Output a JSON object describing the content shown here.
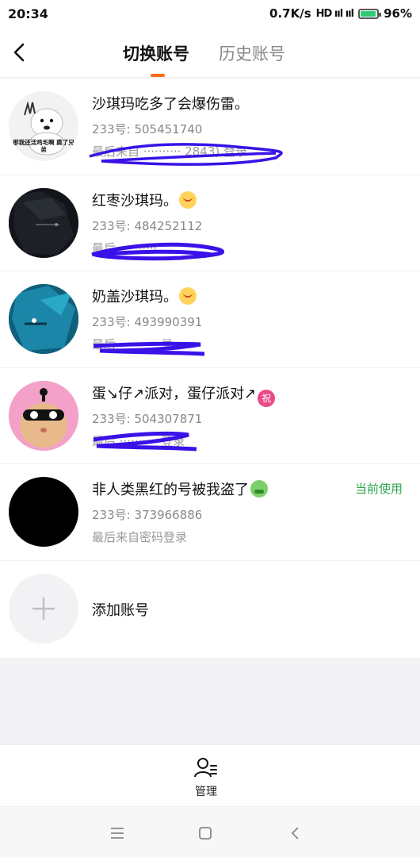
{
  "status_bar": {
    "time": "20:34",
    "speed": "0.7K/s",
    "signal": "HD ııl ııl",
    "battery": "96%",
    "battery_level": 0.96
  },
  "header": {
    "tabs": [
      {
        "label": "切换账号",
        "active": true
      },
      {
        "label": "历史账号",
        "active": false
      }
    ],
    "accent_color": "#ff6a1a"
  },
  "accounts": [
    {
      "name": "沙琪玛吃多了会爆伤雷。",
      "id": "233号: 505451740",
      "last_login": "最后来自 ·········· 2843) 登录",
      "avatar_text": "那我还活鸡毛啊 跳了兄弟"
    },
    {
      "name": "红枣沙琪玛。",
      "emoji": "😤",
      "id": "233号: 484252112",
      "last_login": "最后 ·········· "
    },
    {
      "name": "奶盖沙琪玛。",
      "emoji": "😤",
      "id": "233号: 493990391",
      "last_login": "最后 ·········· 录"
    },
    {
      "name": "蛋↘仔↗派对，蛋仔派对↗",
      "emoji": "祝",
      "id": "233号: 504307871",
      "last_login": "最后 ·········· 登录"
    },
    {
      "name": "非人类黑红的号被我盗了",
      "emoji": "🤮",
      "id": "233号: 373966886",
      "last_login": "最后来自密码登录",
      "current_label": "当前使用"
    }
  ],
  "add_account": {
    "label": "添加账号"
  },
  "bottom_bar": {
    "manage_label": "管理"
  },
  "colors": {
    "current": "#2aa84a",
    "scribble": "#3a12e8"
  }
}
